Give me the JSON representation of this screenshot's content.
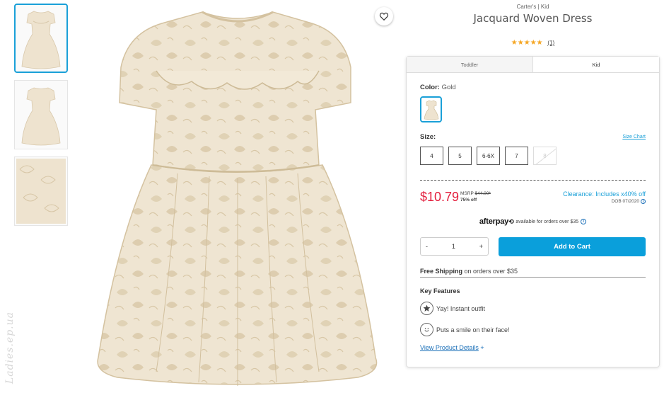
{
  "watermark": "Ladies.ep.ua",
  "product": {
    "brand": "Carter's | Kid",
    "title": "Jacquard Woven Dress",
    "stars": "★★★★★",
    "review_count": "(1)"
  },
  "tabs": [
    {
      "label": "Toddler",
      "active": false
    },
    {
      "label": "Kid",
      "active": true
    }
  ],
  "color": {
    "label": "Color:",
    "value": "Gold"
  },
  "size": {
    "label": "Size:",
    "chart_link": "Size Chart",
    "options": [
      "4",
      "5",
      "6-6X",
      "7",
      "8"
    ],
    "unavailable": [
      "8"
    ]
  },
  "pricing": {
    "price": "$10.79",
    "msrp_label": "MSRP",
    "msrp_value": "$44.00*",
    "discount": "75% off",
    "clearance": "Clearance: Includes x40% off",
    "dob": "DOB 07/2020"
  },
  "afterpay": {
    "logo": "afterpay",
    "text": "available for orders over $35"
  },
  "cart": {
    "minus": "-",
    "quantity": "1",
    "plus": "+",
    "button": "Add to Cart"
  },
  "shipping": {
    "bold": "Free Shipping",
    "rest": " on orders over $35"
  },
  "features": {
    "title": "Key Features",
    "items": [
      "Yay! Instant outfit",
      "Puts a smile on their face!"
    ]
  },
  "details": {
    "label": "View Product Details",
    "suffix": "+"
  },
  "colors": {
    "accent": "#1aa0d8",
    "price_red": "#e31d3c",
    "cart_blue": "#0a9fdb",
    "dress_cream": "#eee3cf",
    "star_gold": "#f5a623"
  }
}
